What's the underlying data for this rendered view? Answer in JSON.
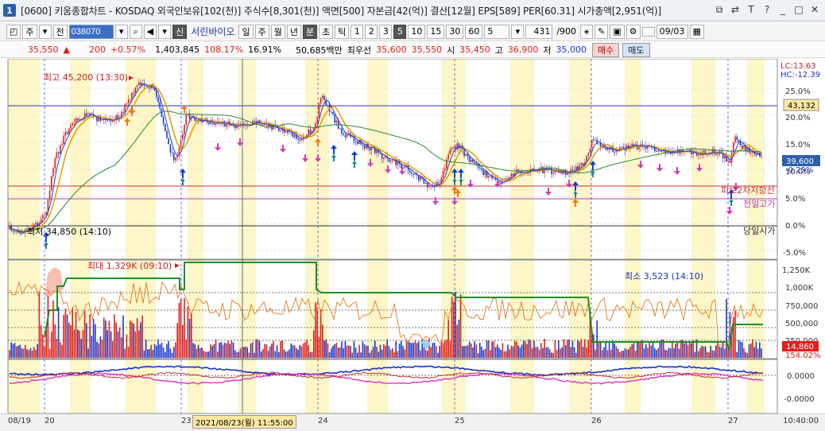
{
  "window": {
    "num": "1",
    "title": "[0600] 키움종합차트 - KOSDAQ 외국인보유[102(천)] 주식수[8,301(천)] 액면[500] 자본금[42(억)] 결산[12월] EPS[589] PER[60.31] 시가총액[2,951(억)]"
  },
  "toolbar": {
    "period_kind": "주",
    "prev_label": "전",
    "code": "038070",
    "new_badge": "신",
    "stock_name": "서린바이오",
    "day": "일",
    "week": "주",
    "month": "월",
    "year": "년",
    "minute": "분",
    "second": "초",
    "tick": "틱",
    "intervals": [
      "1",
      "2",
      "3",
      "5",
      "10",
      "15",
      "30",
      "60"
    ],
    "selected_interval": "5",
    "count_value": "5",
    "range_text": "431",
    "range_total": "/900",
    "date_value": "09/03"
  },
  "quote": {
    "price": "35,550",
    "arrow": "▲",
    "change": "200",
    "change_pct": "+0.57%",
    "volume": "1,403,845",
    "vol_ratio": "108.17%",
    "turnover": "16.91%",
    "amount": "50,685백만",
    "best_label": "최우선",
    "best_ask": "35,600",
    "best_bid": "35,550",
    "open_label": "시",
    "open": "35,450",
    "high_label": "고",
    "high": "36,900",
    "low_label": "저",
    "low": "35,000",
    "buy": "매수",
    "sell": "매도"
  },
  "annotations": {
    "max_label": "최고 45,200 (13:30)",
    "min_label": "최저 34,850 (14:10)",
    "vol_max_label": "최대 1,329K (09:10)",
    "vol_min_label": "최소 3,523 (14:10)",
    "lc_label": "LC:13.63",
    "hc_label": "HC:-12.39",
    "line1_label": "피보2차저항선",
    "line2_label": "전일고가",
    "line3_label": "당일시가",
    "line_value": "43,132",
    "price_tag": "39,600",
    "price_pct": "-0.25%",
    "vol_tag": "14,860",
    "vol_pct": "154.02%"
  },
  "price_axis": [
    "25.0%",
    "20.0%",
    "15.0%",
    "10.0%",
    "5.0%",
    "0.0%",
    "-5.0%"
  ],
  "vol_axis": [
    "1,250K",
    "1,000K",
    "750,000",
    "500,000",
    "250,000"
  ],
  "osc_axis": [
    "0.0000",
    "-0.0000"
  ],
  "dates": [
    "08/19",
    "20",
    "23",
    "24",
    "25",
    "26",
    "27"
  ],
  "crosshair_time": "2021/08/23(월) 11:55:00",
  "clock": "10:40:00",
  "colors": {
    "up": "#e0201c",
    "down": "#1a3ad0",
    "shade": "#fdf6c8",
    "ma_orange": "#e8a000",
    "ma_green": "#2a8a2a",
    "vol_line": "#e07a20",
    "vol_step": "#1f8f1f"
  }
}
